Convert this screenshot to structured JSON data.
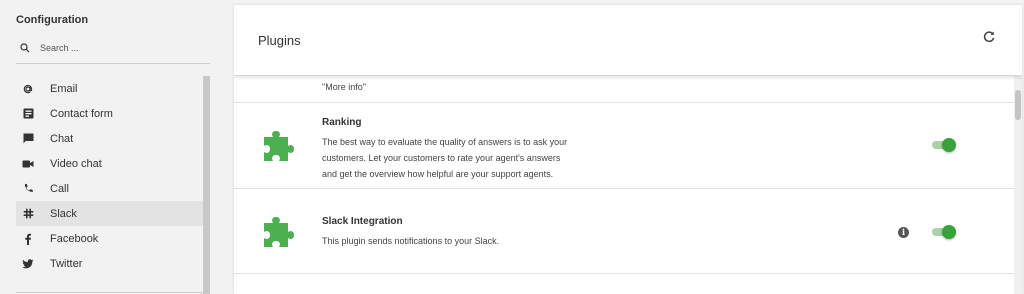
{
  "sidebar": {
    "title": "Configuration",
    "search_placeholder": "Search ...",
    "items": [
      {
        "label": "Email",
        "icon": "at-icon"
      },
      {
        "label": "Contact form",
        "icon": "form-icon"
      },
      {
        "label": "Chat",
        "icon": "chat-icon"
      },
      {
        "label": "Video chat",
        "icon": "video-icon"
      },
      {
        "label": "Call",
        "icon": "phone-icon"
      },
      {
        "label": "Slack",
        "icon": "slack-icon",
        "active": true
      },
      {
        "label": "Facebook",
        "icon": "facebook-icon"
      },
      {
        "label": "Twitter",
        "icon": "twitter-icon"
      }
    ]
  },
  "main": {
    "title": "Plugins",
    "refresh_icon": "refresh-icon",
    "plugins": [
      {
        "title": "",
        "description_lines": [
          "\"More info\""
        ],
        "enabled": null
      },
      {
        "title": "Ranking",
        "description_lines": [
          "The best way to evaluate the quality of answers is to ask your",
          "customers. Let your customers to rate your agent's answers",
          "and get the overview how helpful are your support agents."
        ],
        "enabled": true
      },
      {
        "title": "Slack Integration",
        "description_lines": [
          "This plugin sends notifications to your Slack."
        ],
        "enabled": true,
        "has_info": true
      }
    ]
  },
  "colors": {
    "accent": "#3aa23a",
    "puzzle": "#4caf50",
    "toggle_track": "#a6d4a6"
  }
}
